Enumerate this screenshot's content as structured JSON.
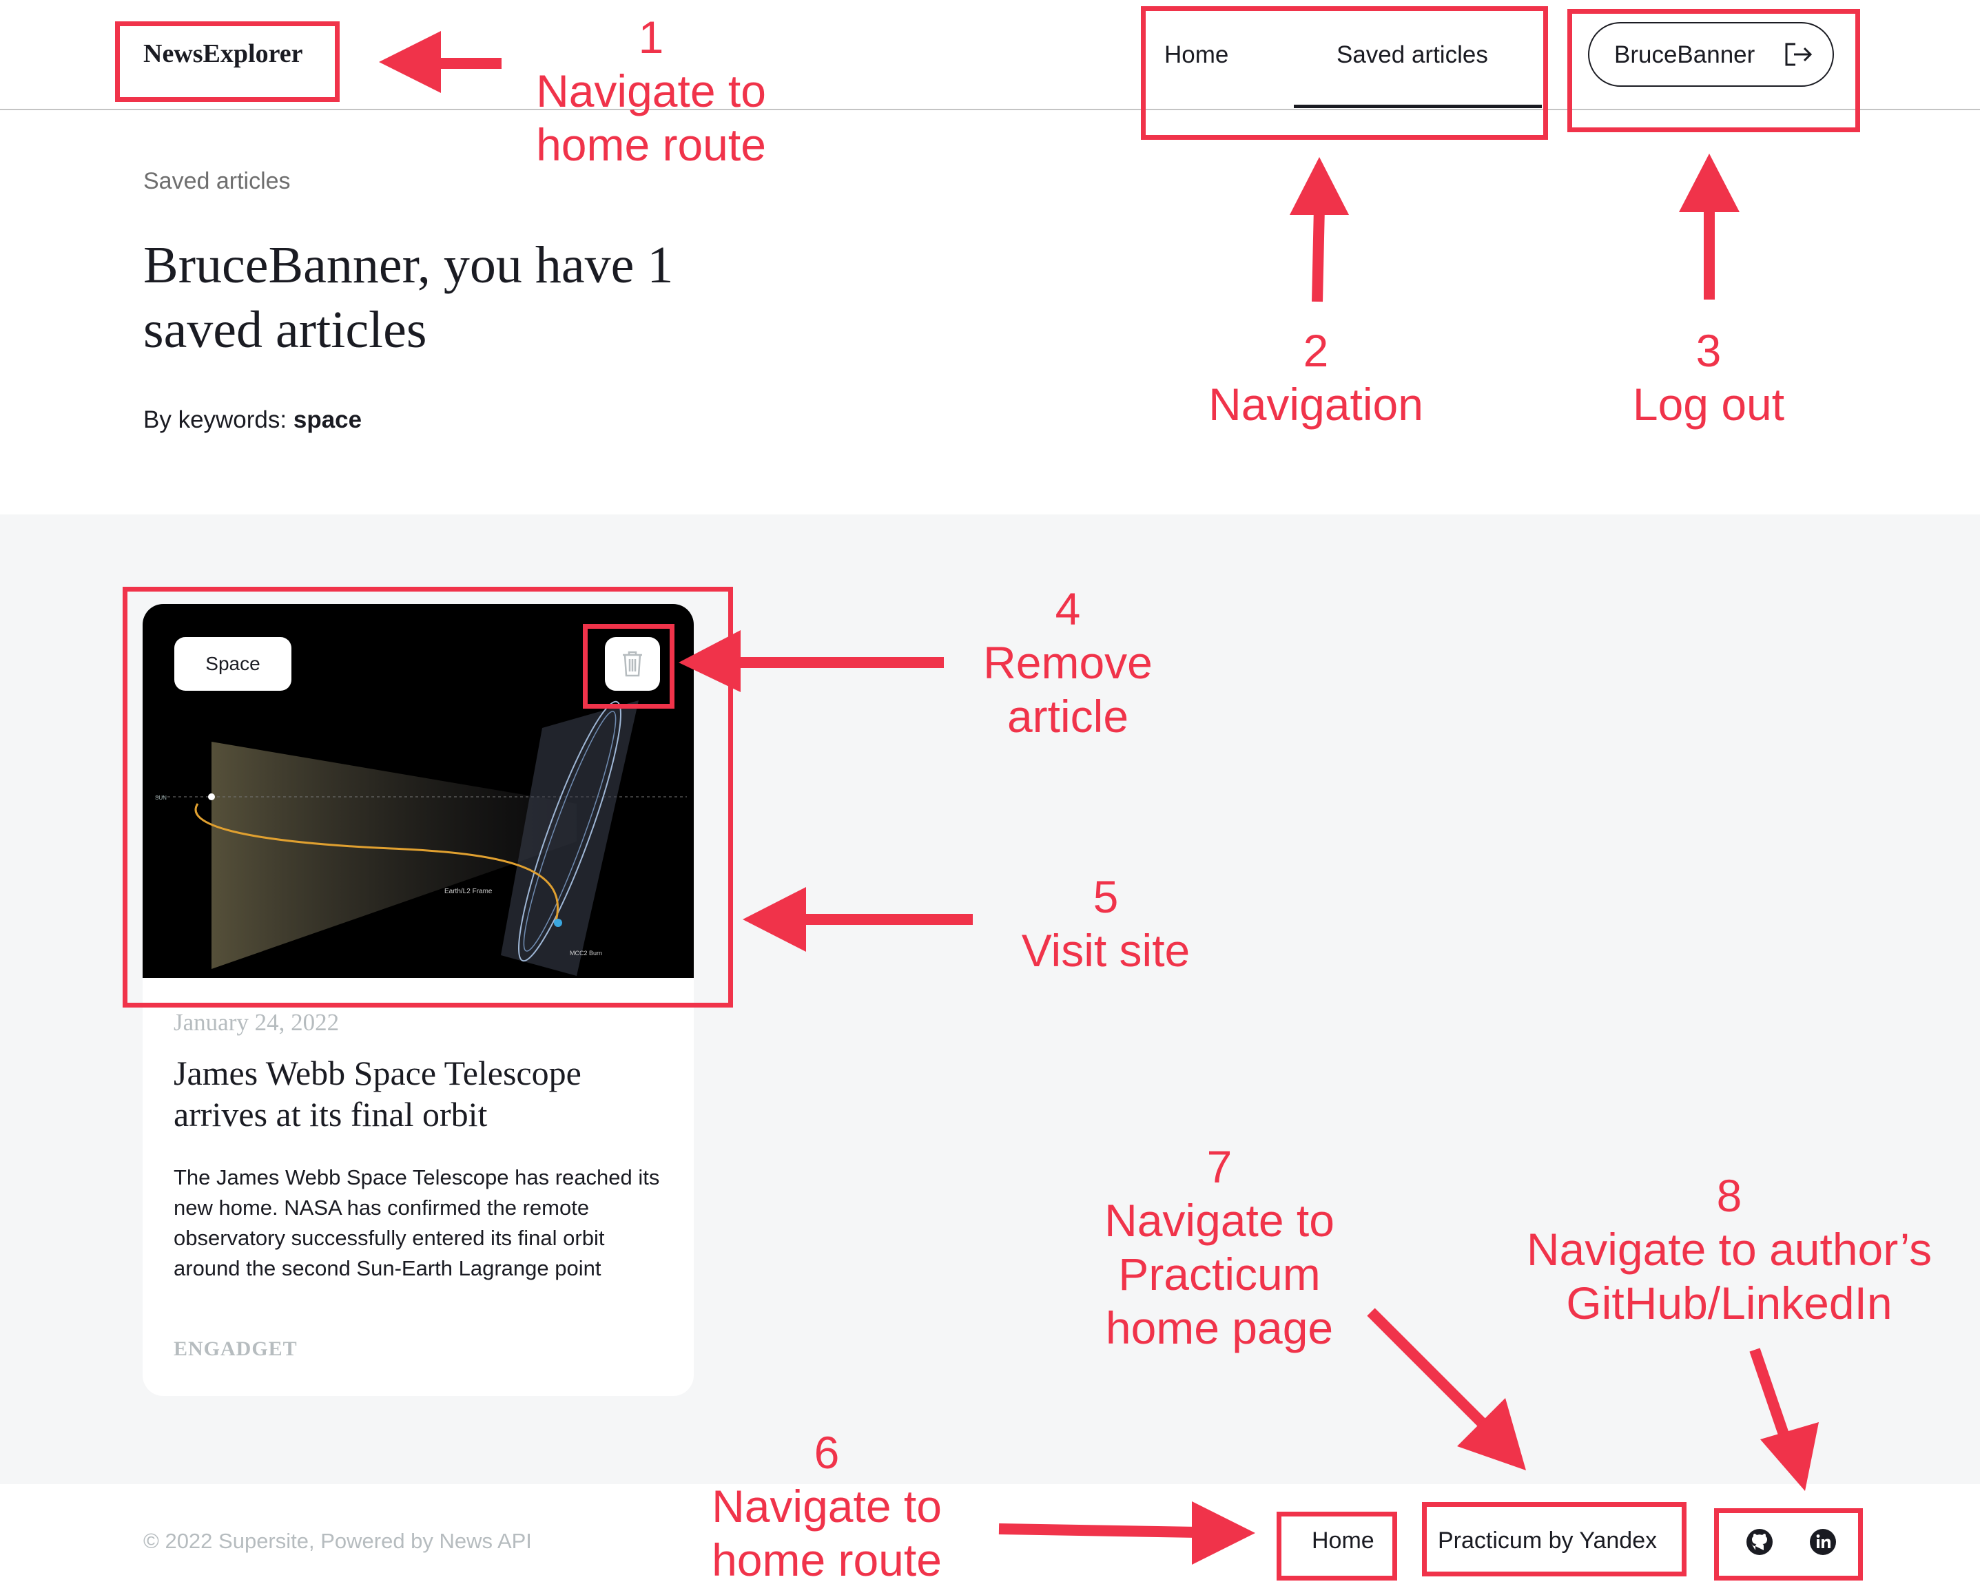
{
  "header": {
    "logo": "NewsExplorer",
    "nav": {
      "home": "Home",
      "saved": "Saved articles"
    },
    "user": {
      "name": "BruceBanner",
      "icon": "logout-icon"
    }
  },
  "intro": {
    "label": "Saved articles",
    "title": "BruceBanner, you have 1 saved articles",
    "keywords_prefix": "By keywords: ",
    "keywords": "space"
  },
  "article": {
    "tag": "Space",
    "date": "January 24, 2022",
    "title": "James Webb Space Telescope arrives at its final orbit",
    "text": "The James Webb Space Telescope has reached its new home. NASA has confirmed the remote observatory successfully entered its final orbit around the second Sun-Earth Lagrange point",
    "source": "ENGADGET",
    "image_labels": {
      "frame": "Earth/L2 Frame",
      "burn": "MCC2 Burn",
      "sun": "SUN"
    }
  },
  "footer": {
    "copyright": "© 2022 Supersite, Powered by News API",
    "home": "Home",
    "practicum": "Practicum by Yandex",
    "icons": [
      "github-icon",
      "linkedin-icon"
    ]
  },
  "annotations": {
    "a1": {
      "num": "1",
      "text1": "Navigate to",
      "text2": "home route"
    },
    "a2": {
      "num": "2",
      "text1": "Navigation"
    },
    "a3": {
      "num": "3",
      "text1": "Log out"
    },
    "a4": {
      "num": "4",
      "text1": "Remove",
      "text2": "article"
    },
    "a5": {
      "num": "5",
      "text1": "Visit site"
    },
    "a6": {
      "num": "6",
      "text1": "Navigate to",
      "text2": "home route"
    },
    "a7": {
      "num": "7",
      "text1": "Navigate to",
      "text2": "Practicum",
      "text3": "home page"
    },
    "a8": {
      "num": "8",
      "text1": "Navigate to author’s",
      "text2": "GitHub/LinkedIn"
    }
  },
  "colors": {
    "annotation": "#f0334a",
    "text": "#1a1b22",
    "muted": "#b6bcbf",
    "section_bg": "#f5f6f7"
  }
}
